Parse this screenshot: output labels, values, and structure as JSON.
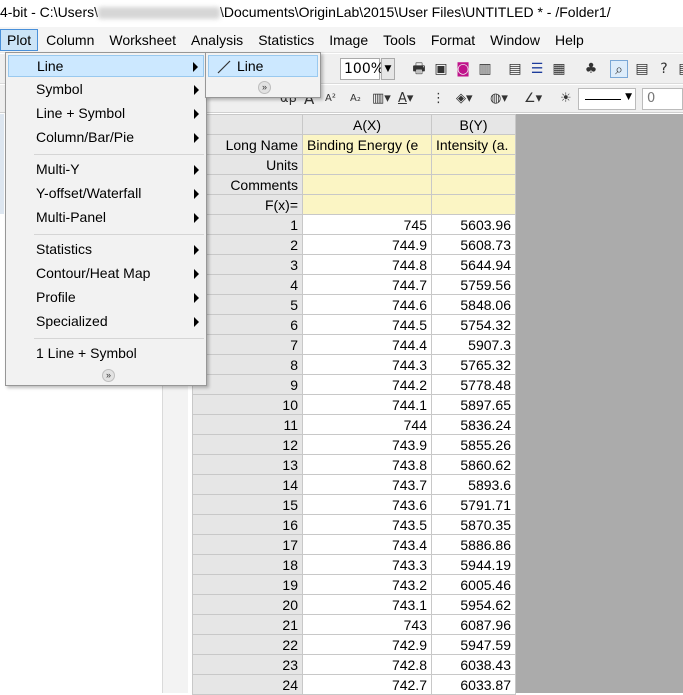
{
  "title": {
    "prefix": "4-bit - C:\\Users\\",
    "suffix": "\\Documents\\OriginLab\\2015\\User Files\\UNTITLED * - /Folder1/"
  },
  "menubar": [
    "Plot",
    "Column",
    "Worksheet",
    "Analysis",
    "Statistics",
    "Image",
    "Tools",
    "Format",
    "Window",
    "Help"
  ],
  "toolbar": {
    "zoom": "100%",
    "line_width_value": "0"
  },
  "plot_menu": {
    "items": [
      {
        "label": "Line",
        "submenu": true
      },
      {
        "label": "Symbol",
        "submenu": true
      },
      {
        "label": "Line + Symbol",
        "submenu": true
      },
      {
        "label": "Column/Bar/Pie",
        "submenu": true
      },
      {
        "label": "Multi-Y",
        "submenu": true
      },
      {
        "label": "Y-offset/Waterfall",
        "submenu": true
      },
      {
        "label": "Multi-Panel",
        "submenu": true
      },
      {
        "label": "Statistics",
        "submenu": true
      },
      {
        "label": "Contour/Heat Map",
        "submenu": true
      },
      {
        "label": "Profile",
        "submenu": true
      },
      {
        "label": "Specialized",
        "submenu": true
      },
      {
        "label": "1 Line + Symbol",
        "submenu": false
      }
    ]
  },
  "line_submenu": {
    "item": "Line"
  },
  "worksheet": {
    "columns": [
      "A(X)",
      "B(Y)"
    ],
    "meta_rows": [
      {
        "label": "Long Name",
        "a": "Binding Energy (e",
        "b": "Intensity (a."
      },
      {
        "label": "Units",
        "a": "",
        "b": ""
      },
      {
        "label": "Comments",
        "a": "",
        "b": ""
      },
      {
        "label": "F(x)=",
        "a": "",
        "b": ""
      }
    ],
    "rows": [
      [
        "1",
        "745",
        "5603.96"
      ],
      [
        "2",
        "744.9",
        "5608.73"
      ],
      [
        "3",
        "744.8",
        "5644.94"
      ],
      [
        "4",
        "744.7",
        "5759.56"
      ],
      [
        "5",
        "744.6",
        "5848.06"
      ],
      [
        "6",
        "744.5",
        "5754.32"
      ],
      [
        "7",
        "744.4",
        "5907.3"
      ],
      [
        "8",
        "744.3",
        "5765.32"
      ],
      [
        "9",
        "744.2",
        "5778.48"
      ],
      [
        "10",
        "744.1",
        "5897.65"
      ],
      [
        "11",
        "744",
        "5836.24"
      ],
      [
        "12",
        "743.9",
        "5855.26"
      ],
      [
        "13",
        "743.8",
        "5860.62"
      ],
      [
        "14",
        "743.7",
        "5893.6"
      ],
      [
        "15",
        "743.6",
        "5791.71"
      ],
      [
        "16",
        "743.5",
        "5870.35"
      ],
      [
        "17",
        "743.4",
        "5886.86"
      ],
      [
        "18",
        "743.3",
        "5944.19"
      ],
      [
        "19",
        "743.2",
        "6005.46"
      ],
      [
        "20",
        "743.1",
        "5954.62"
      ],
      [
        "21",
        "743",
        "6087.96"
      ],
      [
        "22",
        "742.9",
        "5947.59"
      ],
      [
        "23",
        "742.8",
        "6038.43"
      ],
      [
        "24",
        "742.7",
        "6033.87"
      ]
    ]
  }
}
